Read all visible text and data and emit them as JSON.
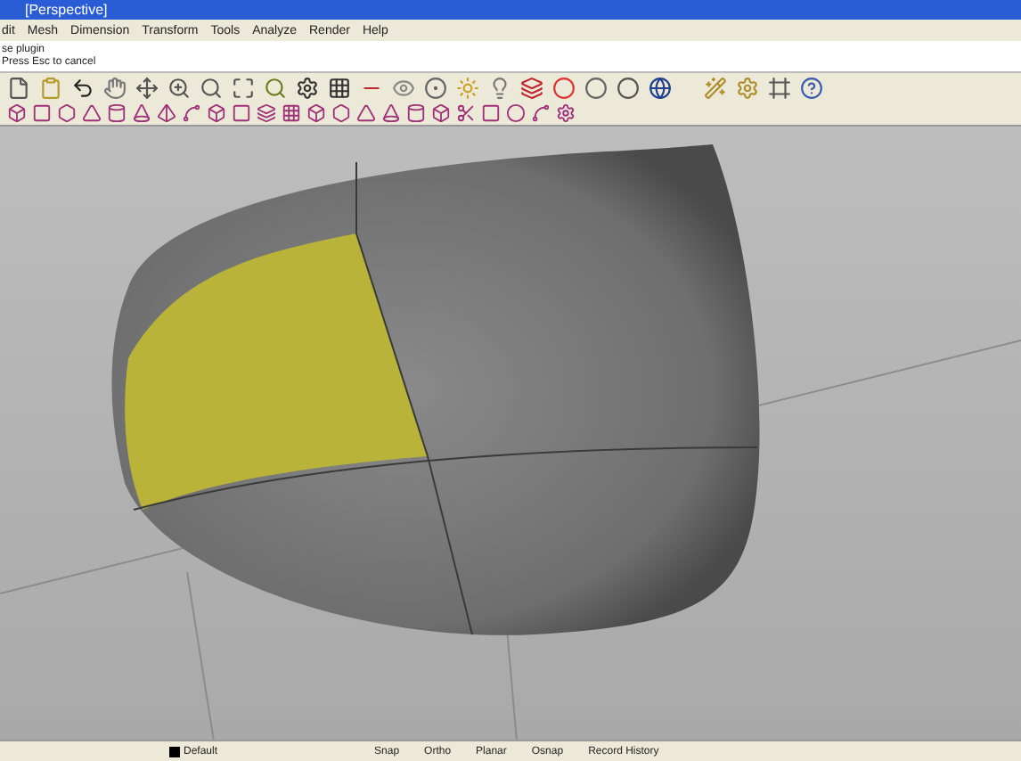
{
  "window": {
    "title": "[Perspective]"
  },
  "menu": [
    "dit",
    "Mesh",
    "Dimension",
    "Transform",
    "Tools",
    "Analyze",
    "Render",
    "Help"
  ],
  "command_history": [
    "se plugin",
    "Press Esc to cancel"
  ],
  "status_bar": {
    "layer": "Default",
    "panes": [
      "Snap",
      "Ortho",
      "Planar",
      "Osnap",
      "Record History"
    ]
  }
}
